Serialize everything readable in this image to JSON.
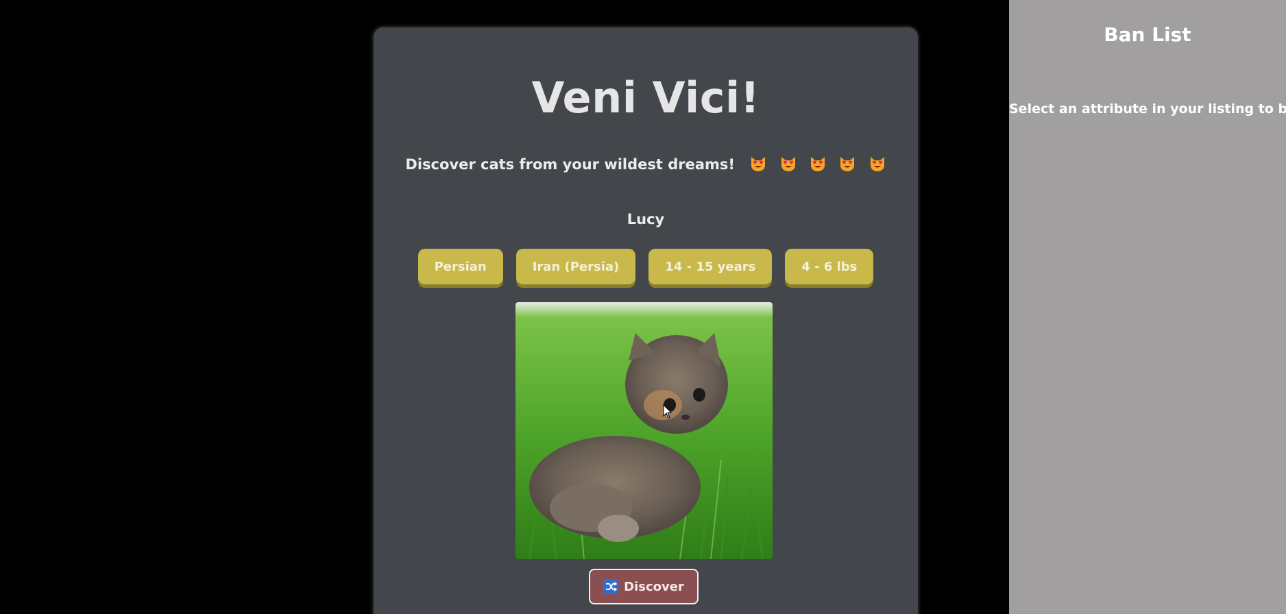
{
  "app": {
    "title": "Veni Vici!",
    "subtitle": "Discover cats from your wildest dreams!",
    "subtitle_emoji": [
      "heart-eyes-cat-icon",
      "heart-eyes-cat-icon",
      "heart-eyes-cat-icon",
      "heart-eyes-cat-icon",
      "heart-eyes-cat-icon"
    ]
  },
  "listing": {
    "name": "Lucy",
    "attributes": [
      "Persian",
      "Iran (Persia)",
      "14 - 15 years",
      "4 - 6 lbs"
    ],
    "image_icon": "persian-kitten-photo"
  },
  "actions": {
    "discover_label": "Discover",
    "discover_icon": "shuffle-icon"
  },
  "ban_list": {
    "title": "Ban List",
    "hint": "Select an attribute in your listing to ban it"
  },
  "colors": {
    "page_bg": "#000000",
    "card_bg": "#43474b",
    "attribute_button": "#c9b94a",
    "discover_button": "#8a4f50",
    "sidebar_bg": "#a29fa0"
  }
}
